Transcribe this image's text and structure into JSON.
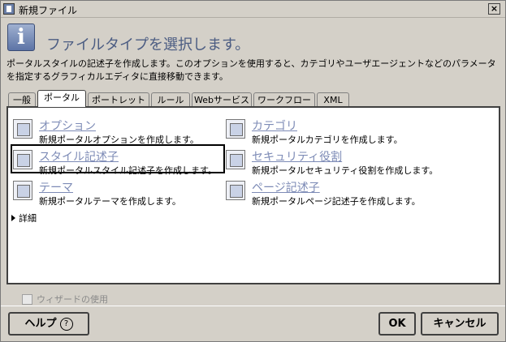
{
  "window": {
    "title": "新規ファイル",
    "close_symbol": "×"
  },
  "header": {
    "icon_glyph": "i",
    "heading": "ファイルタイプを選択します。"
  },
  "description": "ポータルスタイルの記述子を作成します。このオプションを使用すると、カテゴリやユーザエージェントなどのパラメータを指定するグラフィカルエディタに直接移動できます。",
  "tabs": [
    {
      "label": "一般",
      "active": false
    },
    {
      "label": "ポータル",
      "active": true
    },
    {
      "label": "ポートレット",
      "active": false
    },
    {
      "label": "ルール",
      "active": false
    },
    {
      "label": "Webサービス",
      "active": false
    },
    {
      "label": "ワークフロー",
      "active": false
    },
    {
      "label": "XML",
      "active": false
    }
  ],
  "items": [
    {
      "label": "オプション",
      "desc": "新規ポータルオプションを作成します。",
      "icon": "portal-option-icon"
    },
    {
      "label": "カテゴリ",
      "desc": "新規ポータルカテゴリを作成します。",
      "icon": "portal-category-icon"
    },
    {
      "label": "スタイル記述子",
      "desc": "新規ポータルスタイル記述子を作成します。",
      "icon": "style-descriptor-icon",
      "selected": true
    },
    {
      "label": "セキュリティ役割",
      "desc": "新規ポータルセキュリティ役割を作成します。",
      "icon": "security-role-icon"
    },
    {
      "label": "テーマ",
      "desc": "新規ポータルテーマを作成します。",
      "icon": "portal-theme-icon"
    },
    {
      "label": "ページ記述子",
      "desc": "新規ポータルページ記述子を作成します。",
      "icon": "page-descriptor-icon"
    }
  ],
  "details_label": "詳細",
  "wizard_label": "ウィザードの使用",
  "buttons": {
    "help": "ヘルプ",
    "help_symbol": "?",
    "ok": "OK",
    "cancel": "キャンセル"
  }
}
